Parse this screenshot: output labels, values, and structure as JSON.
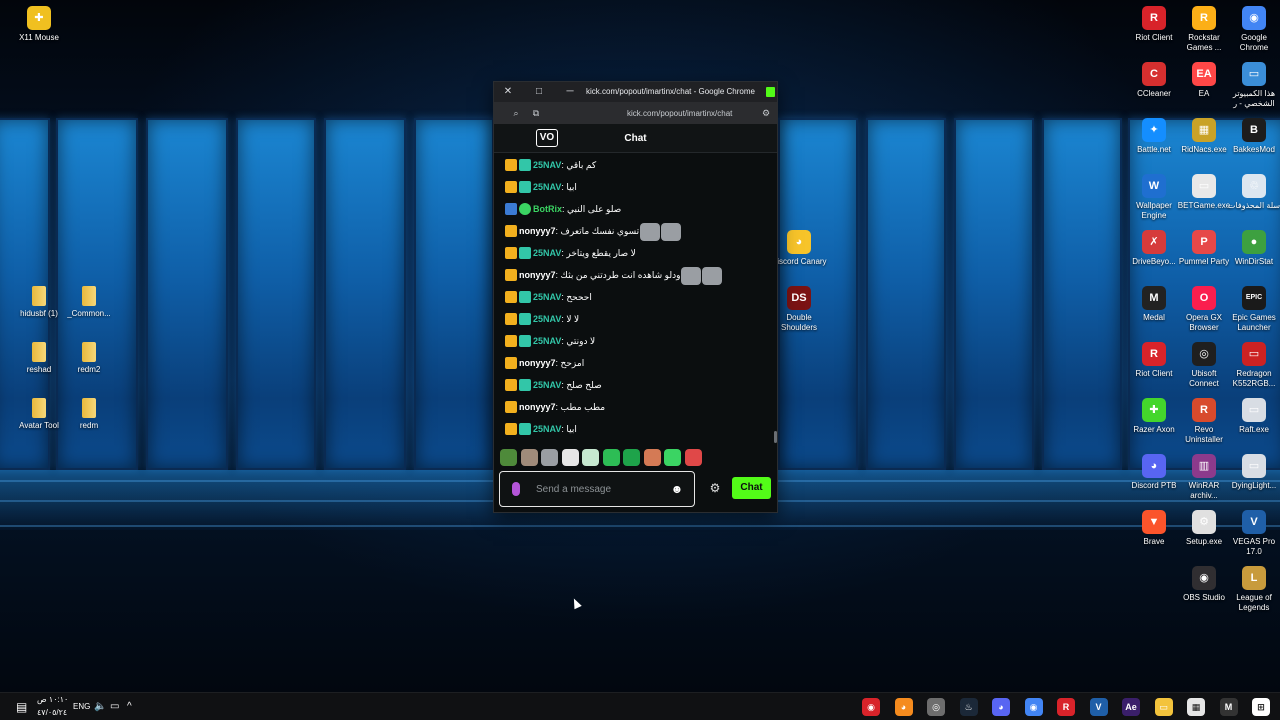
{
  "desktop": {
    "icons_left": [
      {
        "label": "X11 Mouse",
        "icon": "x11-mouse-icon"
      },
      {
        "label": "hidusbf (1)",
        "icon": "folder-icon"
      },
      {
        "label": "_Common...",
        "icon": "folder-icon"
      },
      {
        "label": "reshad",
        "icon": "folder-icon"
      },
      {
        "label": "redm2",
        "icon": "folder-icon"
      },
      {
        "label": "Avatar Tool",
        "icon": "folder-icon"
      },
      {
        "label": "redm",
        "icon": "folder-icon"
      }
    ],
    "icons_mid": [
      {
        "label": "Discord Canary",
        "icon": "discord-canary-icon"
      },
      {
        "label": "Double Shoulders",
        "icon": "double-shoulders-icon"
      }
    ],
    "icons_right": [
      {
        "label": "Riot Client",
        "icon": "riot-client-icon"
      },
      {
        "label": "Rockstar Games ...",
        "icon": "rockstar-icon"
      },
      {
        "label": "Google Chrome",
        "icon": "chrome-icon"
      },
      {
        "label": "CCleaner",
        "icon": "ccleaner-icon"
      },
      {
        "label": "EA",
        "icon": "ea-icon"
      },
      {
        "label": "هذا الكمبيوتر الشخصي - ر",
        "icon": "this-pc-icon"
      },
      {
        "label": "Battle.net",
        "icon": "battlenet-icon"
      },
      {
        "label": "RidNacs.exe",
        "icon": "ridnacs-icon"
      },
      {
        "label": "BakkesMod",
        "icon": "bakkesmod-icon"
      },
      {
        "label": "Wallpaper Engine",
        "icon": "wallpaper-engine-icon"
      },
      {
        "label": "BETGame.exe",
        "icon": "betgame-icon"
      },
      {
        "label": "سلة المحذوفات",
        "icon": "recycle-bin-icon"
      },
      {
        "label": "DriveBeyo...",
        "icon": "drivebeyond-icon"
      },
      {
        "label": "Pummel Party",
        "icon": "pummel-party-icon"
      },
      {
        "label": "WinDirStat",
        "icon": "windirstat-icon"
      },
      {
        "label": "Medal",
        "icon": "medal-icon"
      },
      {
        "label": "Opera GX Browser",
        "icon": "opera-gx-icon"
      },
      {
        "label": "Epic Games Launcher",
        "icon": "epic-games-icon"
      },
      {
        "label": "Riot Client",
        "icon": "riot-client-icon"
      },
      {
        "label": "Ubisoft Connect",
        "icon": "ubisoft-icon"
      },
      {
        "label": "Redragon K552RGB...",
        "icon": "redragon-icon"
      },
      {
        "label": "Razer Axon",
        "icon": "razer-axon-icon"
      },
      {
        "label": "Revo Uninstaller",
        "icon": "revo-icon"
      },
      {
        "label": "Raft.exe",
        "icon": "raft-icon"
      },
      {
        "label": "Discord PTB",
        "icon": "discord-ptb-icon"
      },
      {
        "label": "WinRAR archiv...",
        "icon": "winrar-icon"
      },
      {
        "label": "DyingLight...",
        "icon": "dying-light-icon"
      },
      {
        "label": "Brave",
        "icon": "brave-icon"
      },
      {
        "label": "Setup.exe",
        "icon": "setup-icon"
      },
      {
        "label": "VEGAS Pro 17.0",
        "icon": "vegas-icon"
      },
      {
        "label": "OBS Studio",
        "icon": "obs-icon"
      },
      {
        "label": "League of Legends",
        "icon": "league-icon"
      }
    ]
  },
  "window": {
    "title": "kick.com/popout/imartinx/chat - Google Chrome",
    "url": "kick.com/popout/imartinx/chat"
  },
  "chat": {
    "header": "Chat",
    "logo_text": "VO",
    "messages": [
      {
        "user": "25NAV",
        "text": "كم باقي",
        "badges": [
          "crown",
          "grid"
        ],
        "color": "#32c6a8",
        "emotes": 0
      },
      {
        "user": "25NAV",
        "text": "ابيا",
        "badges": [
          "crown",
          "grid"
        ],
        "color": "#32c6a8",
        "emotes": 0
      },
      {
        "user": "BotRix",
        "text": "صلو على النبي",
        "badges": [
          "sword",
          "verified"
        ],
        "color": "#3bd463",
        "emotes": 0
      },
      {
        "user": "nonyyy7",
        "text": "تسوي نفسك ماتعرف",
        "badges": [
          "crown"
        ],
        "color": "#ffffff",
        "emotes": 2
      },
      {
        "user": "25NAV",
        "text": "لا صار يقطع ويتاخر",
        "badges": [
          "crown",
          "grid"
        ],
        "color": "#32c6a8",
        "emotes": 0
      },
      {
        "user": "nonyyy7",
        "text": "ودلو شاهده انت طردتني من بثك",
        "badges": [
          "crown"
        ],
        "color": "#ffffff",
        "emotes": 2
      },
      {
        "user": "25NAV",
        "text": "احححح",
        "badges": [
          "crown",
          "grid"
        ],
        "color": "#32c6a8",
        "emotes": 0
      },
      {
        "user": "25NAV",
        "text": "لا لا",
        "badges": [
          "crown",
          "grid"
        ],
        "color": "#32c6a8",
        "emotes": 0
      },
      {
        "user": "25NAV",
        "text": "لا دونتي",
        "badges": [
          "crown",
          "grid"
        ],
        "color": "#32c6a8",
        "emotes": 0
      },
      {
        "user": "nonyyy7",
        "text": "امزحح",
        "badges": [
          "crown"
        ],
        "color": "#ffffff",
        "emotes": 0
      },
      {
        "user": "25NAV",
        "text": "صلح صلح",
        "badges": [
          "crown",
          "grid"
        ],
        "color": "#32c6a8",
        "emotes": 0
      },
      {
        "user": "nonyyy7",
        "text": "مطب مطب",
        "badges": [
          "crown"
        ],
        "color": "#ffffff",
        "emotes": 0
      },
      {
        "user": "25NAV",
        "text": "ابيا",
        "badges": [
          "crown",
          "grid"
        ],
        "color": "#32c6a8",
        "emotes": 0
      }
    ],
    "emote_bar": [
      "pepe-emote-icon",
      "cat-emote-icon",
      "cat2-emote-icon",
      "ghost-emote-icon",
      "clown-emote-icon",
      "green-emote-icon",
      "spin-emote-icon",
      "hand-emote-icon",
      "frog-emote-icon",
      "red-emote-icon"
    ],
    "input_placeholder": "Send a message",
    "send_label": "Chat"
  },
  "taskbar": {
    "time": "١٠:١٠ ص",
    "date": "٤٧/٠٥/٢٤",
    "lang": "ENG",
    "apps": [
      "riot-icon",
      "opera-icon",
      "chrome-dev-icon",
      "steam-icon",
      "discord-icon",
      "chrome-icon",
      "rockstar-icon",
      "vegas-icon",
      "after-effects-icon",
      "file-explorer-icon",
      "store-icon",
      "medal-icon",
      "start-icon"
    ]
  },
  "colors": {
    "kick_green": "#53fc18",
    "chat_bg": "#0b0e0f"
  }
}
